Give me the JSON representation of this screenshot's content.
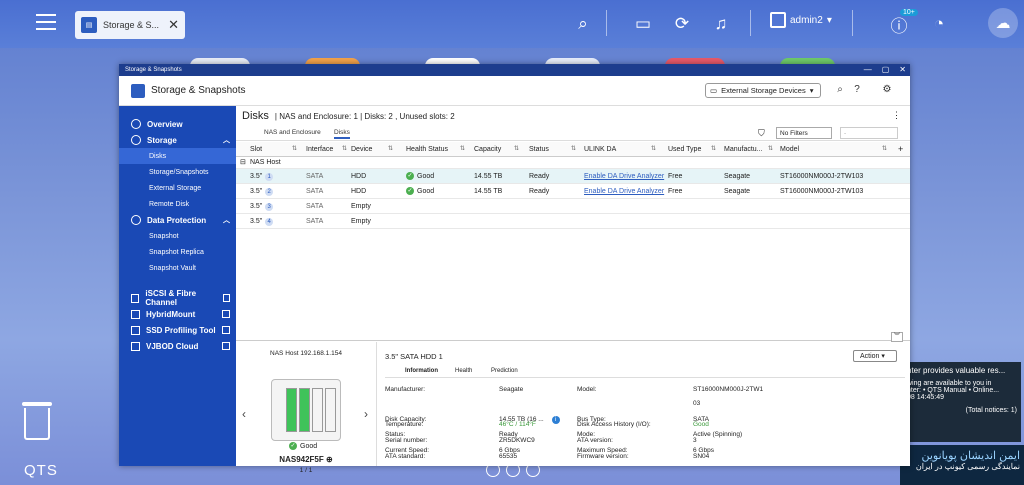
{
  "taskbar": {
    "tab_label": "Storage & S...",
    "user": "admin2",
    "notif_badge": "10+"
  },
  "desktop": {
    "qts_label": "QTS",
    "notification": {
      "title": "nter provides valuable res...",
      "body1": "wing are available to you in",
      "body2": "nter: • QTS Manual • Online...",
      "time": "08 14:45:49",
      "footer": "(Total notices: 1)"
    },
    "persian_line1": "ایمن اندیشان پویانوین",
    "persian_line2": "نمایندگی رسمی کیونپ در ایران"
  },
  "window": {
    "title": "Storage & Snapshots",
    "app_name": "Storage & Snapshots",
    "ext_dropdown": "External Storage Devices"
  },
  "sidebar": {
    "overview": "Overview",
    "storage": "Storage",
    "storage_items": [
      "Disks",
      "Storage/Snapshots",
      "External Storage",
      "Remote Disk"
    ],
    "data_protection": "Data Protection",
    "dp_items": [
      "Snapshot",
      "Snapshot Replica",
      "Snapshot Vault"
    ],
    "external": [
      "iSCSI & Fibre Channel",
      "HybridMount",
      "SSD Profiling Tool",
      "VJBOD Cloud"
    ]
  },
  "disks": {
    "title": "Disks",
    "summary": "| NAS and Enclosure: 1 | Disks: 2 , Unused slots: 2",
    "tabs": [
      "NAS and Enclosure",
      "Disks"
    ],
    "filter": "No Filters",
    "filter2": "-",
    "columns": [
      "Slot",
      "Interface",
      "Device",
      "Health Status",
      "Capacity",
      "Status",
      "ULINK DA",
      "Used Type",
      "Manufactu...",
      "Model"
    ],
    "group": "NAS Host",
    "rows": [
      {
        "slot": "3.5\"",
        "num": "1",
        "iface": "SATA",
        "device": "HDD",
        "health": "Good",
        "cap": "14.55 TB",
        "status": "Ready",
        "ulink": "Enable DA Drive Analyzer",
        "used": "Free",
        "mfr": "Seagate",
        "model": "ST16000NM000J-2TW103"
      },
      {
        "slot": "3.5\"",
        "num": "2",
        "iface": "SATA",
        "device": "HDD",
        "health": "Good",
        "cap": "14.55 TB",
        "status": "Ready",
        "ulink": "Enable DA Drive Analyzer",
        "used": "Free",
        "mfr": "Seagate",
        "model": "ST16000NM000J-2TW103"
      },
      {
        "slot": "3.5\"",
        "num": "3",
        "iface": "SATA",
        "device": "Empty",
        "health": "",
        "cap": "",
        "status": "",
        "ulink": "",
        "used": "",
        "mfr": "",
        "model": ""
      },
      {
        "slot": "3.5\"",
        "num": "4",
        "iface": "SATA",
        "device": "Empty",
        "health": "",
        "cap": "",
        "status": "",
        "ulink": "",
        "used": "",
        "mfr": "",
        "model": ""
      }
    ]
  },
  "nas": {
    "title": "NAS Host 192.168.1.154",
    "name": "NAS942F5F",
    "count": "1 / 1",
    "status": "Good"
  },
  "detail": {
    "title": "3.5\" SATA HDD 1",
    "action": "Action",
    "tabs": [
      "Information",
      "Health",
      "Prediction"
    ],
    "left": [
      [
        "Manufacturer:",
        "Seagate"
      ],
      [
        "Disk Capacity:",
        "14.55 TB (16 ..."
      ],
      [
        "Status:",
        "Ready"
      ],
      [
        "Current Speed:",
        "6 Gbps"
      ],
      [
        "Temperature:",
        "46°C / 114°F"
      ],
      [
        "Serial number:",
        "ZR5DKWC9"
      ],
      [
        "ATA standard:",
        "65535"
      ]
    ],
    "right": [
      [
        "Model:",
        "ST16000NM000J-2TW1"
      ],
      [
        "",
        "03"
      ],
      [
        "Bus Type:",
        "SATA"
      ],
      [
        "Mode:",
        "Active (Spinning)"
      ],
      [
        "Maximum Speed:",
        "6 Gbps"
      ],
      [
        "Disk Access History (I/O):",
        "Good"
      ],
      [
        "ATA version:",
        "3"
      ],
      [
        "Firmware version:",
        "SN04"
      ]
    ]
  }
}
